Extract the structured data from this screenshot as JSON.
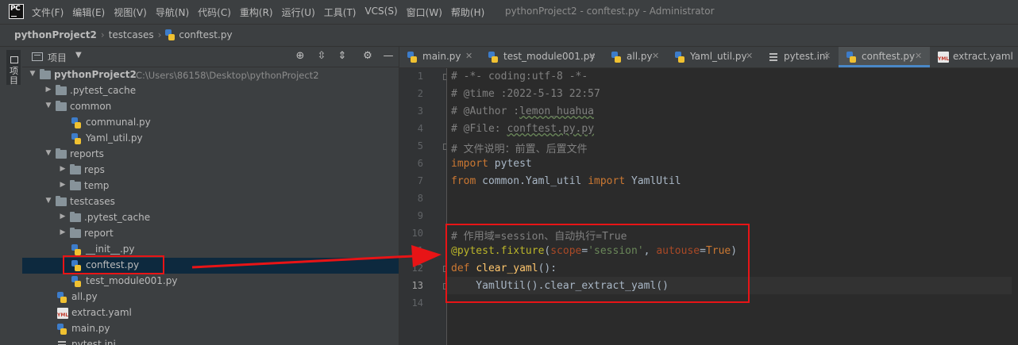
{
  "app": {
    "logo_text": "PC",
    "window_title": "pythonProject2 - conftest.py - Administrator"
  },
  "menu": [
    "文件(F)",
    "编辑(E)",
    "视图(V)",
    "导航(N)",
    "代码(C)",
    "重构(R)",
    "运行(U)",
    "工具(T)",
    "VCS(S)",
    "窗口(W)",
    "帮助(H)"
  ],
  "breadcrumb": [
    "pythonProject2",
    "testcases",
    "conftest.py"
  ],
  "tool_window": {
    "label": "项目"
  },
  "project_panel": {
    "title": "项目",
    "icons": [
      "locate-icon",
      "expand-all-icon",
      "collapse-all-icon",
      "gear-icon",
      "minimize-icon"
    ]
  },
  "tree": [
    {
      "label": "pythonProject2",
      "path": "C:\\Users\\86158\\Desktop\\pythonProject2",
      "type": "folder",
      "depth": 0,
      "expanded": true
    },
    {
      "label": ".pytest_cache",
      "type": "folder",
      "depth": 1,
      "expanded": false
    },
    {
      "label": "common",
      "type": "folder",
      "depth": 1,
      "expanded": true
    },
    {
      "label": "communal.py",
      "type": "py",
      "depth": 2
    },
    {
      "label": "Yaml_util.py",
      "type": "py",
      "depth": 2
    },
    {
      "label": "reports",
      "type": "folder",
      "depth": 1,
      "expanded": true
    },
    {
      "label": "reps",
      "type": "folder",
      "depth": 2,
      "expanded": false
    },
    {
      "label": "temp",
      "type": "folder",
      "depth": 2,
      "expanded": false
    },
    {
      "label": "testcases",
      "type": "folder",
      "depth": 1,
      "expanded": true
    },
    {
      "label": ".pytest_cache",
      "type": "folder",
      "depth": 2,
      "expanded": false
    },
    {
      "label": "report",
      "type": "folder",
      "depth": 2,
      "expanded": false
    },
    {
      "label": "__init__.py",
      "type": "py",
      "depth": 2
    },
    {
      "label": "conftest.py",
      "type": "py",
      "depth": 2,
      "selected": true
    },
    {
      "label": "test_module001.py",
      "type": "py",
      "depth": 2
    },
    {
      "label": "all.py",
      "type": "py",
      "depth": 1
    },
    {
      "label": "extract.yaml",
      "type": "yml",
      "depth": 1
    },
    {
      "label": "main.py",
      "type": "py",
      "depth": 1
    },
    {
      "label": "pytest.ini",
      "type": "ini",
      "depth": 1
    }
  ],
  "tabs": [
    {
      "label": "main.py",
      "icon": "python-file-icon",
      "closable": true
    },
    {
      "label": "test_module001.py",
      "icon": "python-file-icon",
      "closable": true
    },
    {
      "label": "all.py",
      "icon": "python-file-icon",
      "closable": true
    },
    {
      "label": "Yaml_util.py",
      "icon": "python-file-icon",
      "closable": true
    },
    {
      "label": "pytest.ini",
      "icon": "ini-file-icon",
      "closable": true
    },
    {
      "label": "conftest.py",
      "icon": "python-file-icon",
      "closable": true,
      "active": true
    },
    {
      "label": "extract.yaml",
      "icon": "yaml-file-icon",
      "closable": false
    }
  ],
  "editor": {
    "line_numbers": [
      "1",
      "2",
      "3",
      "4",
      "5",
      "6",
      "7",
      "8",
      "9",
      "10",
      "11",
      "12",
      "13",
      "14"
    ],
    "current_line": "13",
    "code": {
      "l1": "# -*- coding:utf-8 -*-",
      "l2": "# @time :2022-5-13 22:57",
      "l3_a": "# @Author :",
      "l3_b": "lemon_huahua",
      "l4_a": "# @File: ",
      "l4_b": "conftest.py.py",
      "l5": "# 文件说明：前置、后置文件",
      "l6_kw": "import",
      "l6_rest": " pytest",
      "l7_kw1": "from",
      "l7_mid": " common.Yaml_util ",
      "l7_kw2": "import",
      "l7_rest": " YamlUtil",
      "l10": "# 作用域=session、自动执行=True",
      "l11_deco": "@pytest.fixture",
      "l11_p1": "(",
      "l11_param1": "scope",
      "l11_eq1": "=",
      "l11_str": "'session'",
      "l11_comma": ", ",
      "l11_param2": "autouse",
      "l11_eq2": "=",
      "l11_kw": "True",
      "l11_p2": ")",
      "l12_kw": "def",
      "l12_sp": " ",
      "l12_fn": "clear_yaml",
      "l12_rest": "():",
      "l13": "    YamlUtil().clear_extract_yaml()"
    }
  },
  "colors": {
    "annotation_red": "#e81416",
    "selection": "#0d293e",
    "accent_tab": "#4a88c7"
  }
}
